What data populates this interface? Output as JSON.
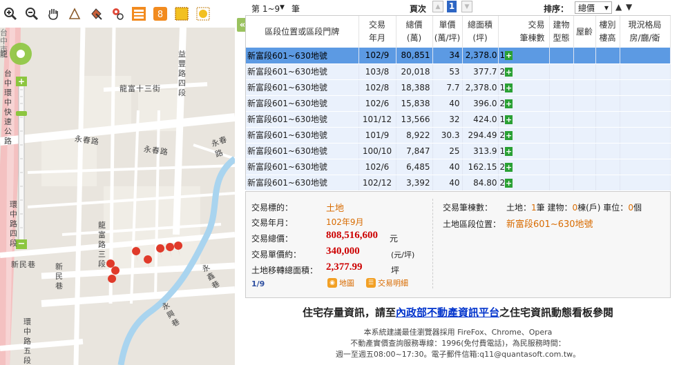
{
  "toolbar": {
    "icons": [
      "zoom-in-icon",
      "zoom-out-icon",
      "pan-hand-icon",
      "measure-distance-icon",
      "measure-area-icon",
      "locate-icon",
      "layers-icon",
      "share-icon",
      "grid-select-icon",
      "sun-select-icon"
    ]
  },
  "map": {
    "labels": {
      "road_left": "台中市",
      "highway": "台中環中快速公路",
      "tiandi": "龍",
      "road_yisheng": "益豐路四段",
      "longfu13": "龍富十三街",
      "yongchun_left": "永春路",
      "yongchun_mid": "永春路",
      "yongchun_right": "永春路",
      "huanzhong4": "環中路四段",
      "longmei3": "龍富路三段",
      "xinmin_left": "新民巷",
      "xinmin2": "新民巷",
      "yonghe": "永鑫巷",
      "dongxing": "永興巷",
      "huanzhong5": "環中路五段"
    }
  },
  "collapse_label": "«",
  "topbar": {
    "range_label": "第 1~9",
    "range_unit": "筆",
    "page_label": "頁次",
    "page_current": "1",
    "sort_label": "排序：",
    "sort_value": "總價",
    "sort_up": "▲",
    "sort_down": "▼"
  },
  "grid": {
    "headers": {
      "location": "區段位置或區段門牌",
      "date_top": "交易",
      "date_bot": "年月",
      "total_top": "總價",
      "total_bot": "(萬)",
      "unit_top": "單價",
      "unit_bot": "(萬/坪)",
      "area_top": "總面積",
      "area_bot": "(坪)",
      "count_top": "交易",
      "count_bot": "筆棟數",
      "btype_top": "建物",
      "btype_bot": "型態",
      "age": "屋齡",
      "floor_top": "樓別",
      "floor_bot": "樓高",
      "layout_top": "現況格局",
      "layout_bot": "房/廳/衛"
    },
    "rows": [
      {
        "loc": "新富段601~630地號",
        "date": "102/9",
        "total": "80,851",
        "unit": "34",
        "area": "2,378.0",
        "count": "1"
      },
      {
        "loc": "新富段601~630地號",
        "date": "103/8",
        "total": "20,018",
        "unit": "53",
        "area": "377.7",
        "count": "2"
      },
      {
        "loc": "新富段601~630地號",
        "date": "102/8",
        "total": "18,388",
        "unit": "7.7",
        "area": "2,378.0",
        "count": "1"
      },
      {
        "loc": "新富段601~630地號",
        "date": "102/6",
        "total": "15,838",
        "unit": "40",
        "area": "396.0",
        "count": "2"
      },
      {
        "loc": "新富段601~630地號",
        "date": "101/12",
        "total": "13,566",
        "unit": "32",
        "area": "424.0",
        "count": "1"
      },
      {
        "loc": "新富段601~630地號",
        "date": "101/9",
        "total": "8,922",
        "unit": "30.3",
        "area": "294.49",
        "count": "2"
      },
      {
        "loc": "新富段601~630地號",
        "date": "100/10",
        "total": "7,847",
        "unit": "25",
        "area": "313.9",
        "count": "1"
      },
      {
        "loc": "新富段601~630地號",
        "date": "102/6",
        "total": "6,485",
        "unit": "40",
        "area": "162.15",
        "count": "2"
      },
      {
        "loc": "新富段601~630地號",
        "date": "102/12",
        "total": "3,392",
        "unit": "40",
        "area": "84.80",
        "count": "2"
      }
    ],
    "plus_label": "+"
  },
  "detail": {
    "type_label": "交易標的：",
    "type_value": "土地",
    "date_label": "交易年月：",
    "date_value": "102年9月",
    "total_label": "交易總價：",
    "total_value": "808,516,600",
    "total_unit": "元",
    "unit_label": "交易單價約：",
    "unit_value": "340,000",
    "unit_unit": "(元/坪)",
    "area_label": "土地移轉總面積：",
    "area_value": "2,377.99",
    "area_unit": "坪",
    "count_label": "交易筆棟數：",
    "count_text1": "土地：",
    "count_v1": "1",
    "count_text2": "筆 建物：",
    "count_v2": "0",
    "count_text3": "棟(戶) 車位：",
    "count_v3": "0",
    "count_text4": "個",
    "loc_label": "土地區段位置：",
    "loc_value": "新富段601~630地號",
    "pager": "1/9",
    "map_link": "地圖",
    "detail_link": "交易明細"
  },
  "notice": {
    "pre": "住宅存量資訊，請至",
    "link": "內政部不動產資訊平台",
    "post": "之住宅資訊動態看板參閱"
  },
  "footer": {
    "line1": "本系統建議最佳瀏覽器採用 FireFox、Chrome、Opera",
    "line2": "不動產實價查詢服務專線：1996(免付費電話)，為民服務時間：",
    "line3": "週一至週五08:00~17:30。電子郵件信箱:q11@quantasoft.com.tw。"
  },
  "colors": {
    "selected_row": "#5c9ae3",
    "row_bg": "#eaf1fc",
    "accent_orange": "#d86b00",
    "accent_red": "#cc0000",
    "plus_green": "#2aa034"
  }
}
